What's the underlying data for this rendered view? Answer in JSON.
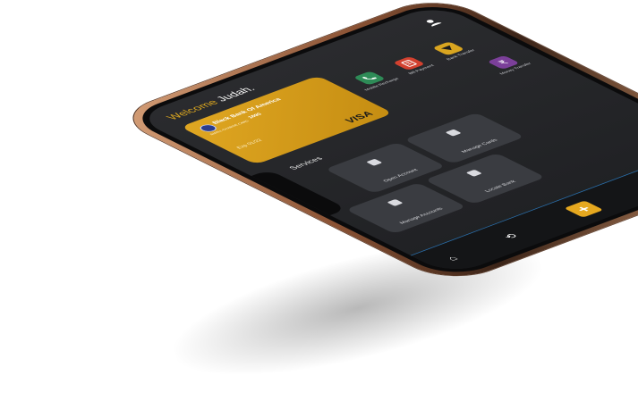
{
  "header": {
    "greeting": "Welcome",
    "user_name": "Judah.",
    "profile_icon": "person-icon"
  },
  "card": {
    "bank_name": "Black Bank Of America",
    "subtitle": "SMALL CHARGE CARD",
    "number": "1690",
    "expiry": "Exp 01/22",
    "network": "VISA",
    "color": "#e0a722"
  },
  "services": {
    "title": "Services",
    "items": [
      {
        "label": "Mobile Recharge",
        "icon": "phone-icon",
        "color": "#2e8b57"
      },
      {
        "label": "Bill Payment",
        "icon": "bill-icon",
        "color": "#d2412f"
      },
      {
        "label": "Bank Transfer",
        "icon": "transfer-icon",
        "color": "#d9a520"
      },
      {
        "label": "Money Transfer",
        "icon": "money-icon",
        "color": "#7b3f99"
      }
    ]
  },
  "tiles": [
    {
      "label": "Open Account",
      "icon": "account-icon"
    },
    {
      "label": "Manage Accounts",
      "icon": "accounts-icon"
    },
    {
      "label": "Manage Cards",
      "icon": "card-icon"
    },
    {
      "label": "Locate Bank",
      "icon": "locate-icon"
    }
  ],
  "nav": {
    "items": [
      {
        "name": "home",
        "icon": "home-icon",
        "glyph": "⌂"
      },
      {
        "name": "history",
        "icon": "history-icon",
        "glyph": "⟲"
      },
      {
        "name": "add",
        "icon": "plus-icon",
        "glyph": "+"
      },
      {
        "name": "bank",
        "icon": "bank-icon",
        "glyph": "▦"
      },
      {
        "name": "settings",
        "icon": "settings-icon",
        "glyph": "⊛"
      }
    ]
  },
  "accent_color": "#e6a81f"
}
